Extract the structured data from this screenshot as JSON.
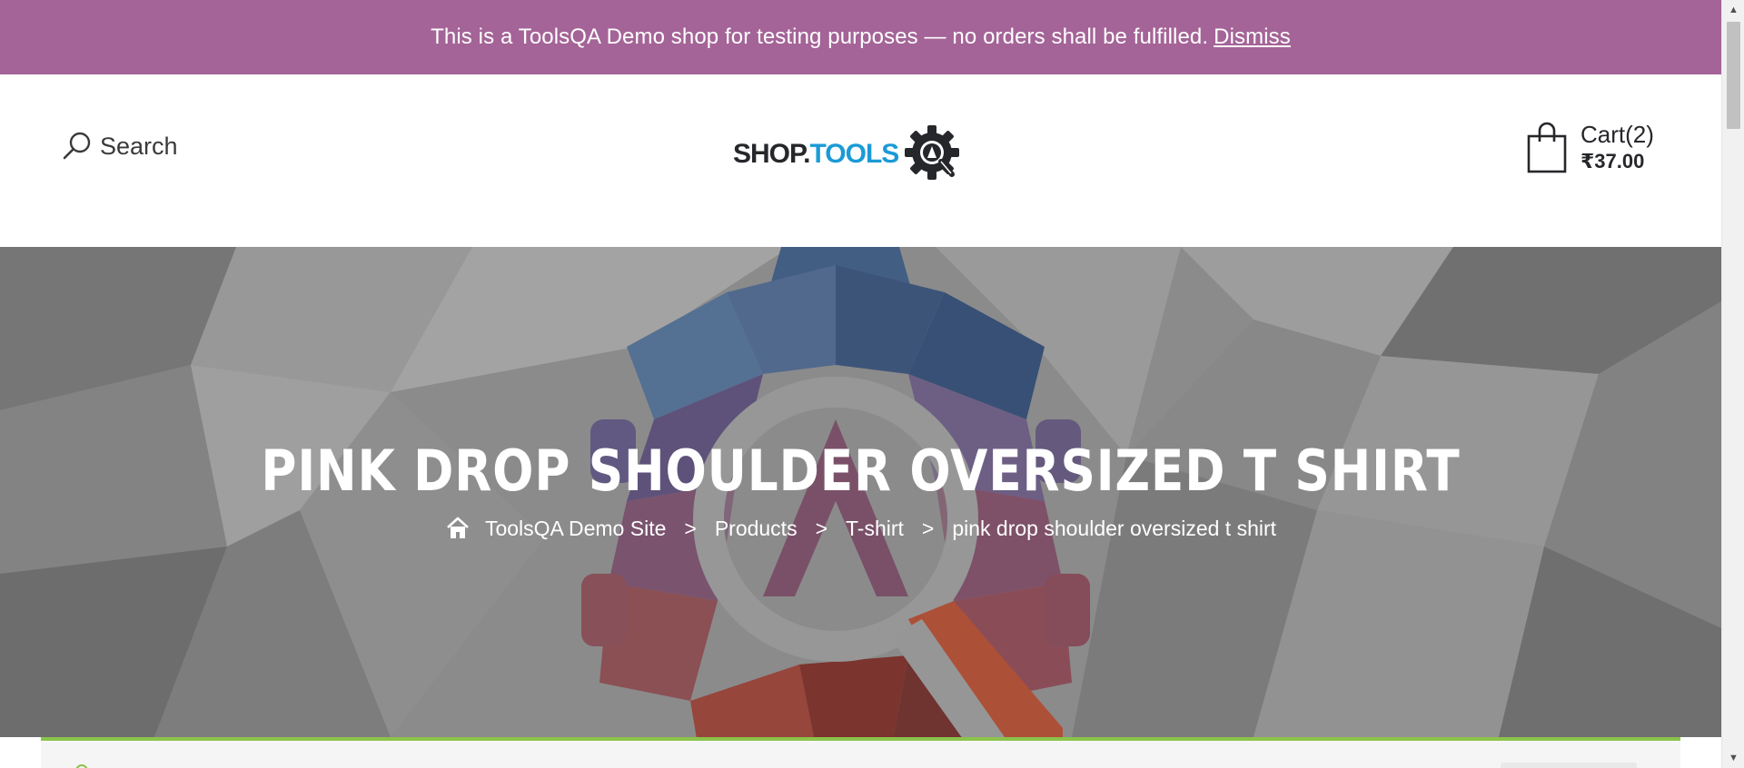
{
  "notice": {
    "text": "This is a ToolsQA Demo shop for testing purposes — no orders shall be fulfilled.",
    "dismiss_label": "Dismiss",
    "background": "#a46497"
  },
  "header": {
    "search_label": "Search",
    "search_icon": "search-icon",
    "logo": {
      "part1": "SHOP.",
      "part2": "TOOLS",
      "emblem_icon": "gear-magnifier-icon"
    },
    "cart": {
      "label": "Cart(2)",
      "total": "₹37.00",
      "icon": "shopping-bag-icon"
    }
  },
  "hero": {
    "title": "PINK DROP SHOULDER OVERSIZED T SHIRT",
    "breadcrumb": {
      "home_icon": "home-icon",
      "separator": ">",
      "items": [
        "ToolsQA Demo Site",
        "Products",
        "T-shirt",
        "pink drop shoulder oversized t shirt"
      ]
    }
  },
  "colors": {
    "accent_green": "#8bc34a",
    "logo_blue": "#1b9ad6",
    "text_dark": "#26272b"
  }
}
